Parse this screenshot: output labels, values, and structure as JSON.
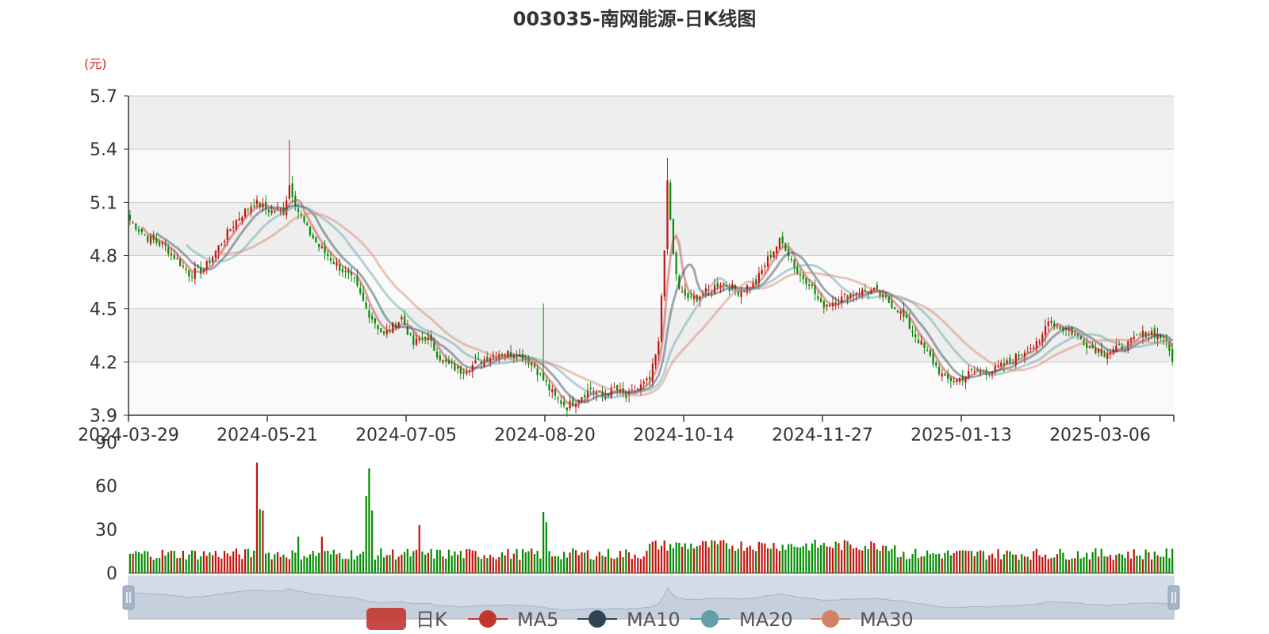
{
  "chart_data": {
    "type": "candlestick",
    "title": "003035-南网能源-日K线图",
    "ylabel": "(元)",
    "ylim": [
      3.9,
      5.7
    ],
    "yticks": [
      "5.7",
      "5.4",
      "5.1",
      "4.8",
      "4.5",
      "4.2",
      "3.9"
    ],
    "xticks": [
      "2024-03-29",
      "2024-05-21",
      "2024-07-05",
      "2024-08-20",
      "2024-10-14",
      "2024-11-27",
      "2025-01-13",
      "2025-03-06"
    ],
    "volume_ylim": [
      0,
      90
    ],
    "volume_yticks": [
      "90",
      "60",
      "30",
      "0"
    ],
    "close_keypoints": [
      [
        0,
        5.0
      ],
      [
        6,
        4.9
      ],
      [
        12,
        4.85
      ],
      [
        20,
        4.7
      ],
      [
        25,
        4.72
      ],
      [
        30,
        4.85
      ],
      [
        36,
        5.0
      ],
      [
        42,
        5.1
      ],
      [
        48,
        5.05
      ],
      [
        52,
        5.05
      ],
      [
        54,
        5.2
      ],
      [
        57,
        5.05
      ],
      [
        60,
        4.95
      ],
      [
        64,
        4.85
      ],
      [
        70,
        4.75
      ],
      [
        76,
        4.65
      ],
      [
        80,
        4.5
      ],
      [
        86,
        4.35
      ],
      [
        92,
        4.45
      ],
      [
        96,
        4.3
      ],
      [
        100,
        4.35
      ],
      [
        106,
        4.2
      ],
      [
        112,
        4.15
      ],
      [
        118,
        4.2
      ],
      [
        124,
        4.25
      ],
      [
        130,
        4.25
      ],
      [
        136,
        4.2
      ],
      [
        140,
        4.1
      ],
      [
        144,
        4.0
      ],
      [
        148,
        3.95
      ],
      [
        152,
        4.0
      ],
      [
        156,
        4.05
      ],
      [
        160,
        4.0
      ],
      [
        164,
        4.05
      ],
      [
        168,
        4.0
      ],
      [
        172,
        4.05
      ],
      [
        176,
        4.1
      ],
      [
        179,
        4.3
      ],
      [
        181,
        4.85
      ],
      [
        182,
        5.2
      ],
      [
        184,
        4.8
      ],
      [
        186,
        4.6
      ],
      [
        190,
        4.55
      ],
      [
        196,
        4.6
      ],
      [
        200,
        4.65
      ],
      [
        206,
        4.6
      ],
      [
        212,
        4.65
      ],
      [
        216,
        4.78
      ],
      [
        220,
        4.88
      ],
      [
        222,
        4.85
      ],
      [
        226,
        4.7
      ],
      [
        230,
        4.65
      ],
      [
        234,
        4.52
      ],
      [
        240,
        4.55
      ],
      [
        246,
        4.6
      ],
      [
        252,
        4.6
      ],
      [
        256,
        4.55
      ],
      [
        260,
        4.5
      ],
      [
        264,
        4.4
      ],
      [
        268,
        4.3
      ],
      [
        272,
        4.2
      ],
      [
        276,
        4.1
      ],
      [
        280,
        4.1
      ],
      [
        286,
        4.15
      ],
      [
        292,
        4.15
      ],
      [
        298,
        4.2
      ],
      [
        304,
        4.28
      ],
      [
        308,
        4.3
      ],
      [
        311,
        4.45
      ],
      [
        314,
        4.4
      ],
      [
        318,
        4.38
      ],
      [
        322,
        4.33
      ],
      [
        326,
        4.28
      ],
      [
        330,
        4.25
      ],
      [
        334,
        4.27
      ],
      [
        338,
        4.3
      ],
      [
        342,
        4.35
      ],
      [
        346,
        4.37
      ],
      [
        350,
        4.33
      ],
      [
        353,
        4.22
      ]
    ],
    "volume_peaks": [
      [
        43,
        76
      ],
      [
        44,
        44
      ],
      [
        45,
        43
      ],
      [
        80,
        53
      ],
      [
        81,
        72
      ],
      [
        82,
        43
      ],
      [
        140,
        42
      ],
      [
        141,
        35
      ],
      [
        98,
        33
      ],
      [
        57,
        25
      ],
      [
        65,
        25
      ]
    ],
    "series": [
      {
        "name": "日K",
        "color": "#c23531"
      },
      {
        "name": "MA5",
        "color": "#c23531"
      },
      {
        "name": "MA10",
        "color": "#2f4554"
      },
      {
        "name": "MA20",
        "color": "#61a0a8"
      },
      {
        "name": "MA30",
        "color": "#d48265"
      }
    ],
    "colors": {
      "up": "#c0150e",
      "down": "#058d05",
      "grid": "#cccccc",
      "band_dark": "#eeeeee",
      "band_light": "#fafafa"
    }
  }
}
